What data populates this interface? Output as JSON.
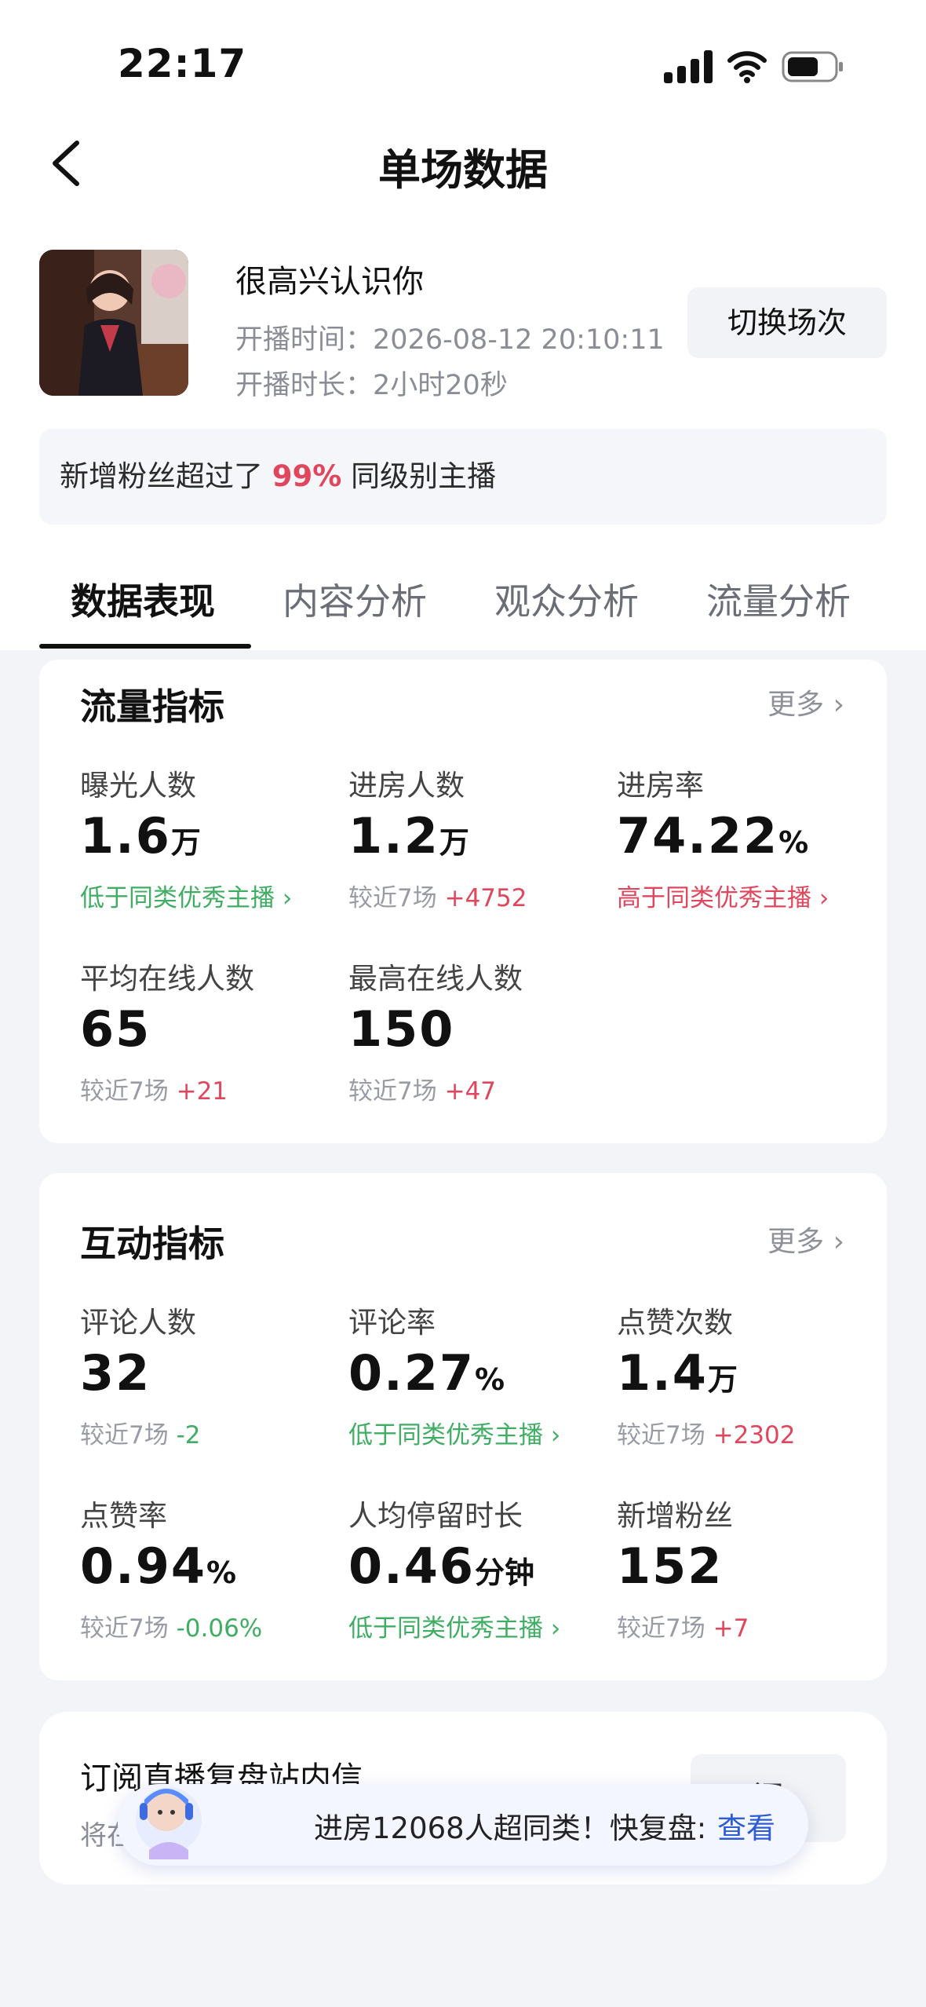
{
  "status_bar": {
    "time": "22:17"
  },
  "nav": {
    "title": "单场数据"
  },
  "streamer": {
    "name": "很高兴认识你",
    "start_time_label": "开播时间：",
    "start_time": "2026-08-12 20:10:11",
    "duration_label": "开播时长：",
    "duration": "2小时20秒",
    "switch_label": "切换场次"
  },
  "rank": {
    "prefix": "新增粉丝超过了",
    "percent": "99%",
    "suffix": "同级别主播"
  },
  "tabs": [
    {
      "label": "数据表现",
      "active": true
    },
    {
      "label": "内容分析",
      "active": false
    },
    {
      "label": "观众分析",
      "active": false
    },
    {
      "label": "流量分析",
      "active": false
    }
  ],
  "traffic": {
    "title": "流量指标",
    "more": "更多",
    "metrics": [
      {
        "label": "曝光人数",
        "value": "1.6",
        "unit": "万",
        "note": "低于同类优秀主播"
      },
      {
        "label": "进房人数",
        "value": "1.2",
        "unit": "万",
        "compare_label": "较近7场",
        "delta": "+4752"
      },
      {
        "label": "进房率",
        "value": "74.22",
        "unit": "%",
        "note": "高于同类优秀主播"
      },
      {
        "label": "平均在线人数",
        "value": "65",
        "compare_label": "较近7场",
        "delta": "+21"
      },
      {
        "label": "最高在线人数",
        "value": "150",
        "compare_label": "较近7场",
        "delta": "+47"
      }
    ]
  },
  "interaction": {
    "title": "互动指标",
    "more": "更多",
    "metrics": [
      {
        "label": "评论人数",
        "value": "32",
        "compare_label": "较近7场",
        "delta": "-2"
      },
      {
        "label": "评论率",
        "value": "0.27",
        "unit": "%",
        "note": "低于同类优秀主播"
      },
      {
        "label": "点赞次数",
        "value": "1.4",
        "unit": "万",
        "compare_label": "较近7场",
        "delta": "+2302"
      },
      {
        "label": "点赞率",
        "value": "0.94",
        "unit": "%",
        "compare_label": "较近7场",
        "delta": "-0.06%"
      },
      {
        "label": "人均停留时长",
        "value": "0.46",
        "unit": "分钟",
        "note": "低于同类优秀主播"
      },
      {
        "label": "新增粉丝",
        "value": "152",
        "compare_label": "较近7场",
        "delta": "+7"
      }
    ]
  },
  "subscribe": {
    "title": "订阅直播复盘站内信",
    "desc": "将在",
    "button": "阅"
  },
  "banner": {
    "text": "进房12068人超同类！快复盘:",
    "link": "查看"
  },
  "colors": {
    "positive": "#e0475d",
    "negative": "#3fae63",
    "link": "#2e5bd8"
  }
}
